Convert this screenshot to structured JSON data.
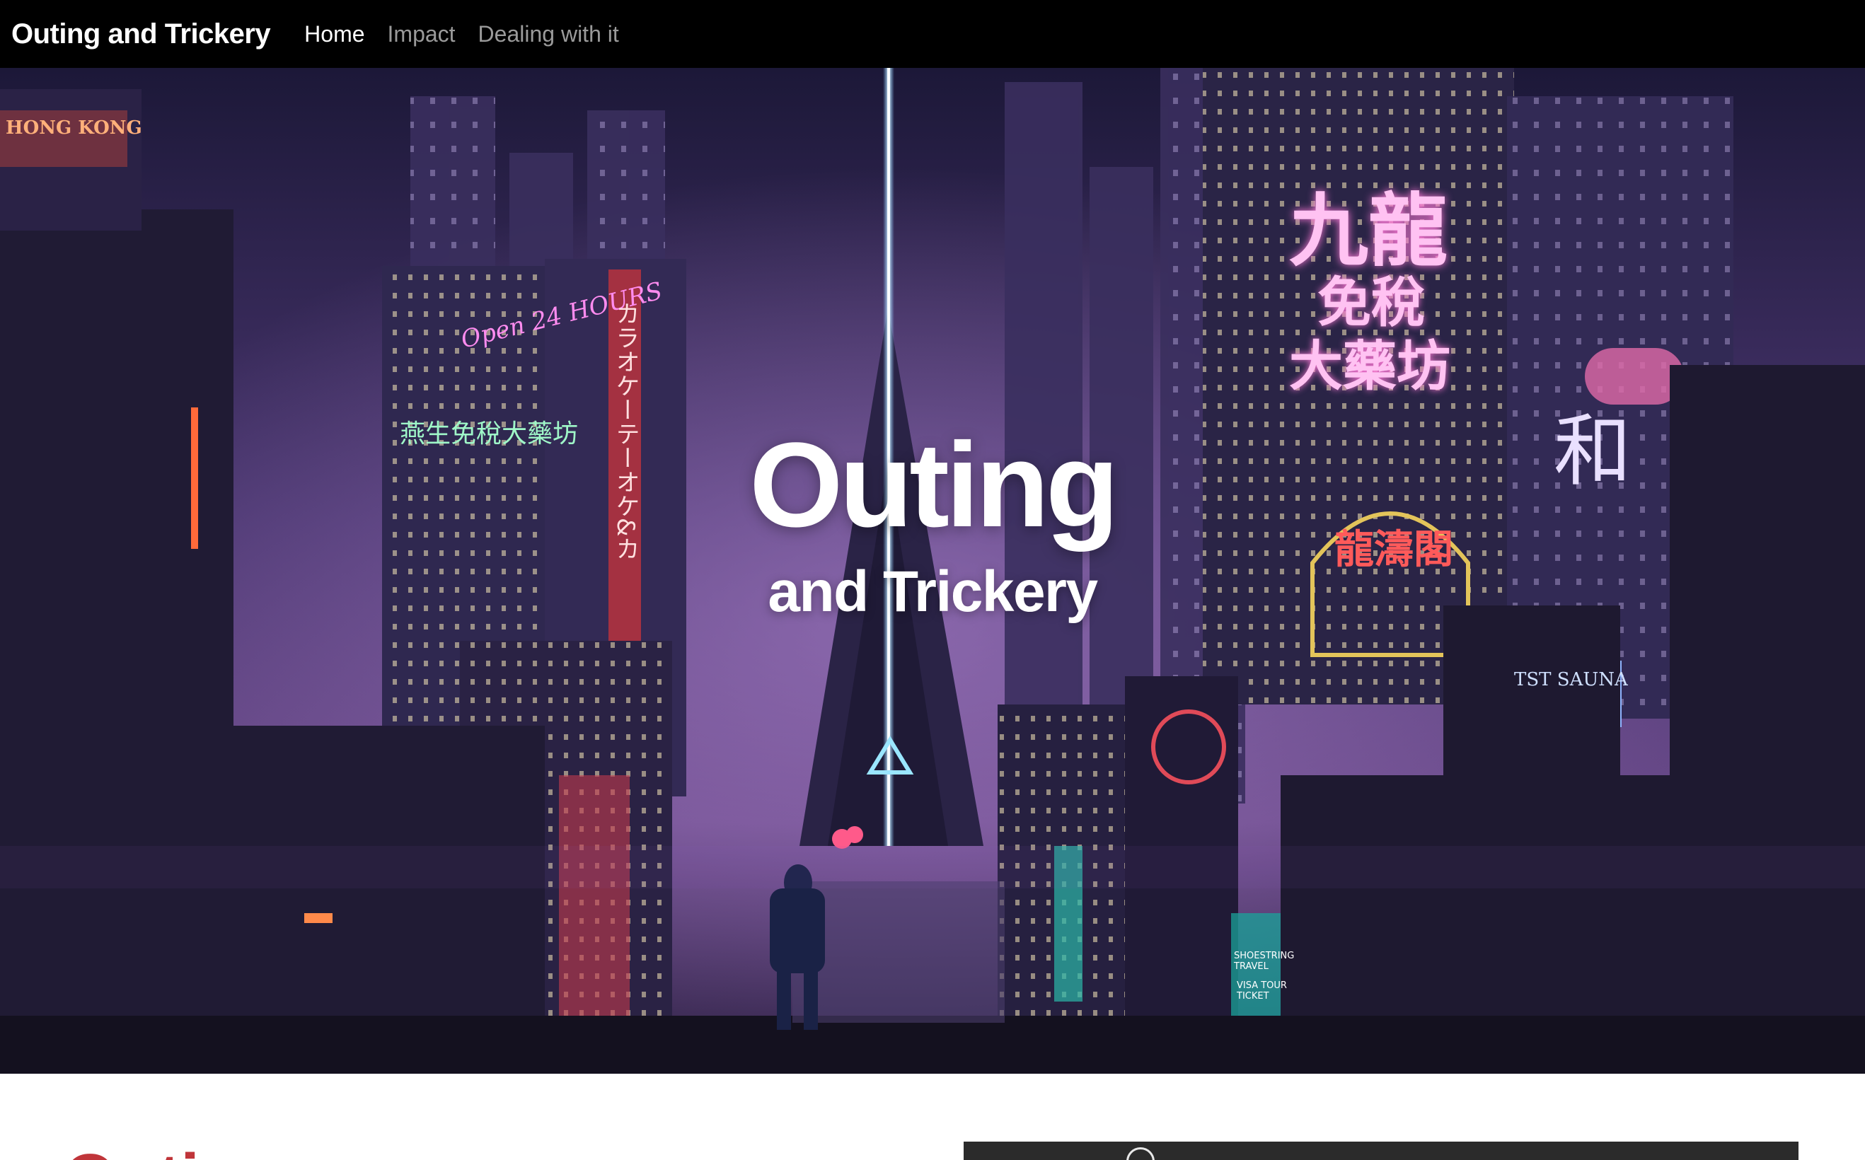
{
  "nav": {
    "brand": "Outing and Trickery",
    "links": [
      {
        "label": "Home",
        "active": true
      },
      {
        "label": "Impact",
        "active": false
      },
      {
        "label": "Dealing with it",
        "active": false
      }
    ]
  },
  "hero": {
    "title": "Outing",
    "subtitle": "and Trickery",
    "signs": {
      "hong_kong": "HONG KONG",
      "hours": "Open 24 HOURS",
      "karaoke": "カラオケーテーオケ&カ",
      "chinese_left": "燕生免稅大藥坊",
      "chinese_right_1": "九龍",
      "chinese_right_2": "免稅",
      "chinese_right_3": "大藥坊",
      "wa": "和",
      "dragon": "龍濤閣",
      "sauna": "TST SAUNA",
      "travel": "SHOESTRING TRAVEL",
      "visa": "VISA TOUR TICKET"
    }
  },
  "content": {
    "heading_partial": "Outi"
  }
}
